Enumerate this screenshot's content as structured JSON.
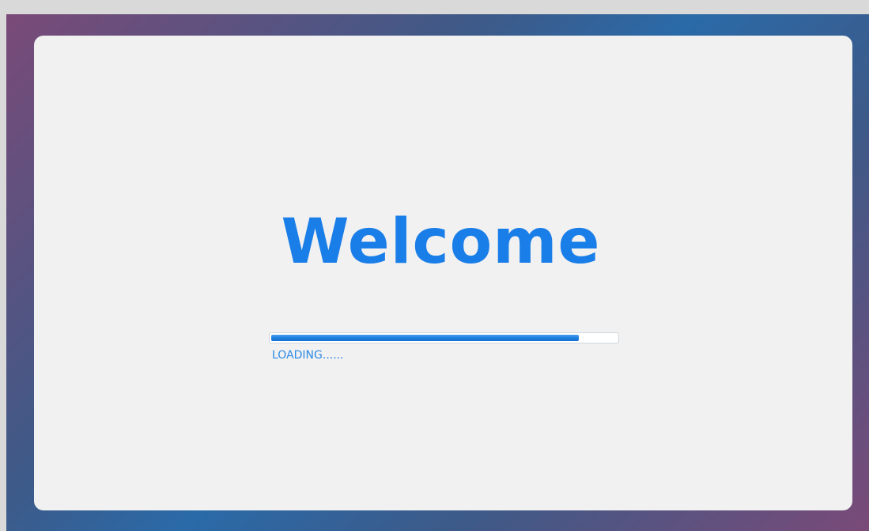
{
  "splash": {
    "title": "Welcome",
    "loading_text": "LOADING......",
    "progress": 0.89
  },
  "colors": {
    "accent": "#1a7ee8",
    "card_background": "#f1f1f1",
    "progress_fill": "#1f7fe0"
  }
}
